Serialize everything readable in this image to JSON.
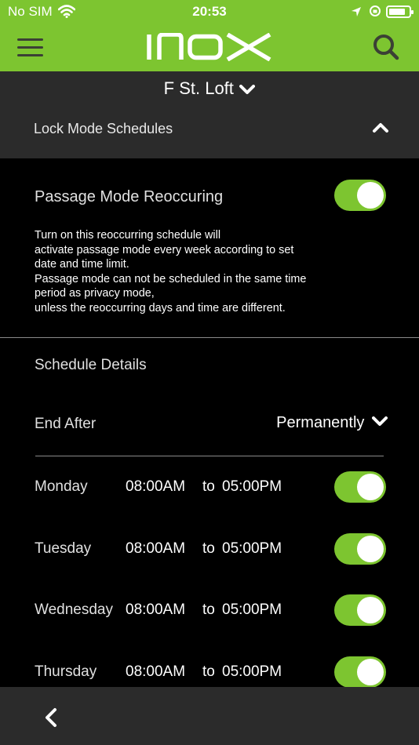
{
  "status_bar": {
    "carrier": "No SIM",
    "time": "20:53",
    "battery_percent": 85
  },
  "header": {
    "logo_text": "INOX",
    "logo_icon": "inox-logo-icon",
    "menu_icon": "hamburger-menu-icon",
    "search_icon": "search-icon"
  },
  "location": {
    "name": "F St. Loft",
    "icon": "chevron-down-icon"
  },
  "section": {
    "title": "Lock Mode Schedules",
    "icon": "chevron-up-icon"
  },
  "passage": {
    "title": "Passage Mode Reoccuring",
    "enabled": true,
    "description_lines": [
      "Turn on this reoccurring schedule will",
      "activate passage mode every week according to set",
      "date and time limit.",
      "Passage mode can not be scheduled in the same time",
      "period as privacy mode,",
      "unless the reoccurring days and time are different."
    ]
  },
  "details": {
    "title": "Schedule Details",
    "end_after_label": "End After",
    "end_after_value": "Permanently"
  },
  "days": [
    {
      "name": "Monday",
      "start": "08:00AM",
      "to": "to",
      "end": "05:00PM",
      "enabled": true
    },
    {
      "name": "Tuesday",
      "start": "08:00AM",
      "to": "to",
      "end": "05:00PM",
      "enabled": true
    },
    {
      "name": "Wednesday",
      "start": "08:00AM",
      "to": "to",
      "end": "05:00PM",
      "enabled": true
    },
    {
      "name": "Thursday",
      "start": "08:00AM",
      "to": "to",
      "end": "05:00PM",
      "enabled": true
    }
  ],
  "bottom_bar": {
    "back_icon": "back-chevron-icon"
  },
  "colors": {
    "accent": "#7dc530",
    "panel": "#2b2b2b",
    "background": "#000000",
    "header_icon": "#3b4035"
  }
}
